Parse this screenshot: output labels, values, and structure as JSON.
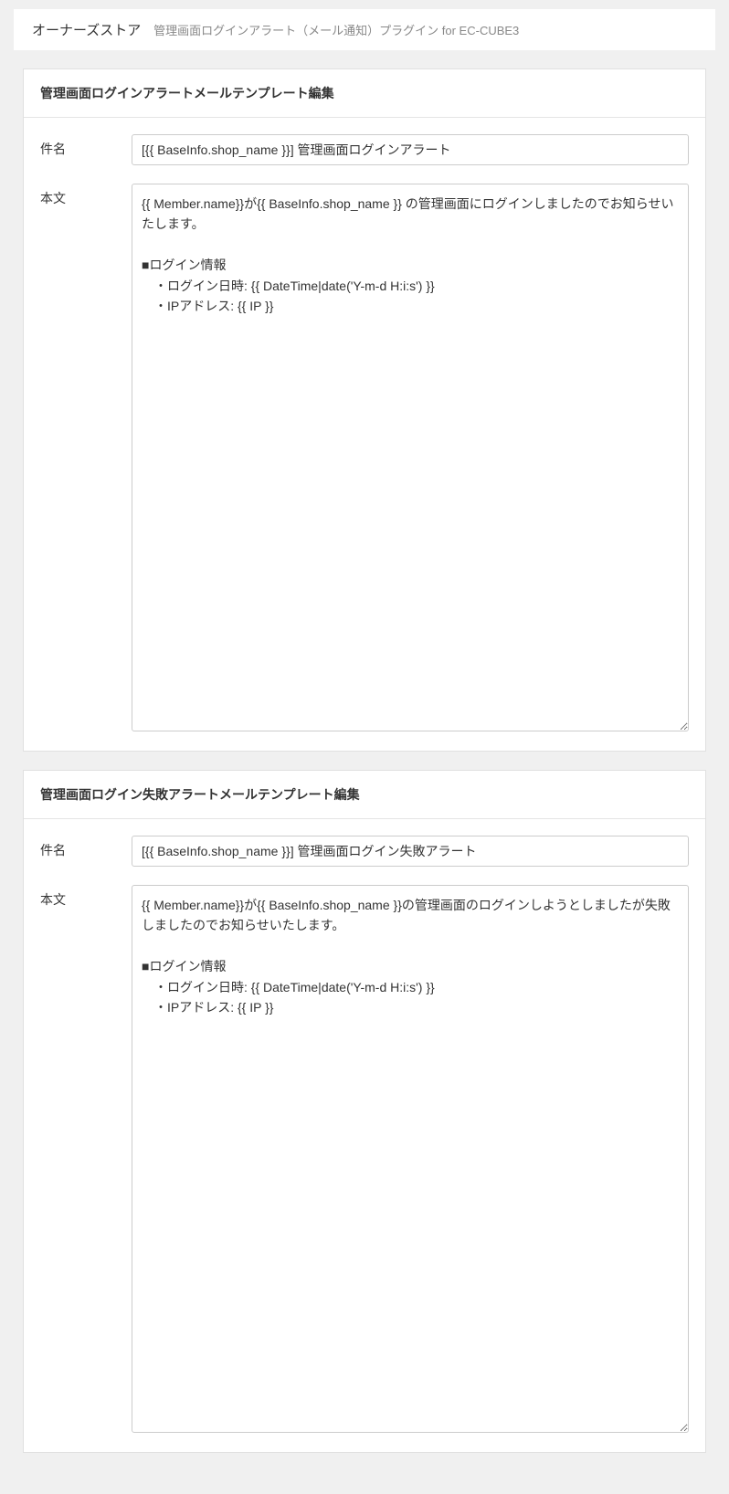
{
  "breadcrumb": {
    "main": "オーナーズストア",
    "sub": "管理画面ログインアラート（メール通知）プラグイン for EC-CUBE3"
  },
  "panel1": {
    "title": "管理画面ログインアラートメールテンプレート編集",
    "subject_label": "件名",
    "subject_value": "[{{ BaseInfo.shop_name }}] 管理画面ログインアラート",
    "body_label": "本文",
    "body_value": "{{ Member.name}}が{{ BaseInfo.shop_name }} の管理画面にログインしましたのでお知らせいたします。\n\n■ログイン情報\n　・ログイン日時: {{ DateTime|date('Y-m-d H:i:s') }}\n　・IPアドレス: {{ IP }}"
  },
  "panel2": {
    "title": "管理画面ログイン失敗アラートメールテンプレート編集",
    "subject_label": "件名",
    "subject_value": "[{{ BaseInfo.shop_name }}] 管理画面ログイン失敗アラート",
    "body_label": "本文",
    "body_value": "{{ Member.name}}が{{ BaseInfo.shop_name }}の管理画面のログインしようとしましたが失敗しましたのでお知らせいたします。\n\n■ログイン情報\n　・ログイン日時: {{ DateTime|date('Y-m-d H:i:s') }}\n　・IPアドレス: {{ IP }}"
  }
}
